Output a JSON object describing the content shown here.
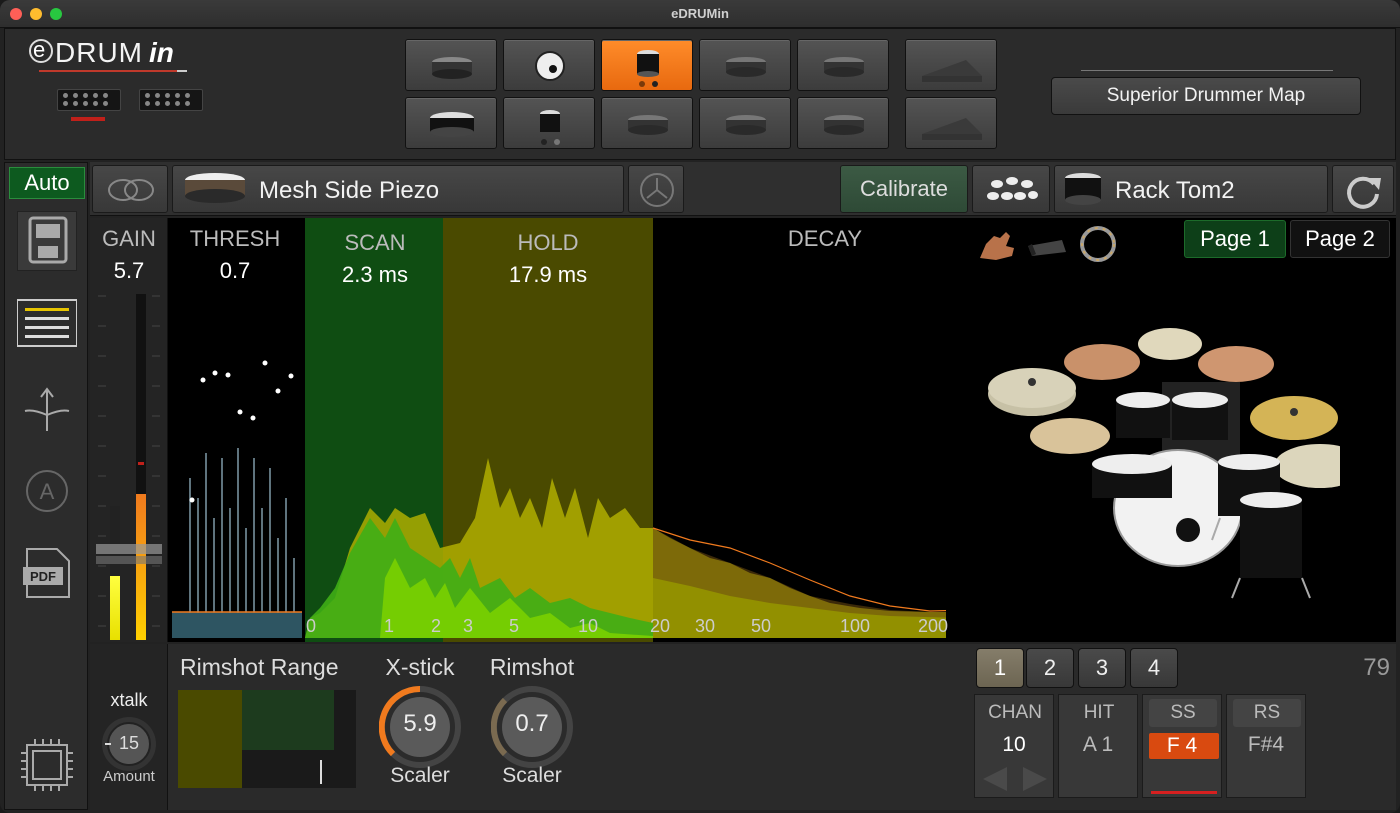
{
  "window": {
    "title": "eDRUMin"
  },
  "logo": {
    "text_e": "e",
    "text_drum": "DRUM",
    "text_in": "in"
  },
  "top": {
    "map_button": "Superior Drummer Map"
  },
  "sidebar": {
    "auto_label": "Auto"
  },
  "toolbar": {
    "input_type": "Mesh Side Piezo",
    "calibrate_label": "Calibrate",
    "instrument": "Rack Tom2"
  },
  "params": {
    "gain_label": "GAIN",
    "gain_value": "5.7",
    "thresh_label": "THRESH",
    "thresh_value": "0.7",
    "scan_label": "SCAN",
    "scan_value": "2.3 ms",
    "hold_label": "HOLD",
    "hold_value": "17.9 ms",
    "decay_label": "DECAY"
  },
  "pages": {
    "page1": "Page 1",
    "page2": "Page 2"
  },
  "axis_ticks": [
    "0",
    "1",
    "2",
    "3",
    "5",
    "10",
    "20",
    "30",
    "50",
    "100",
    "200"
  ],
  "xtalk": {
    "label": "xtalk",
    "value": "15",
    "sub": "Amount"
  },
  "rimshot_range": {
    "label": "Rimshot Range"
  },
  "xstick": {
    "label": "X-stick",
    "value": "5.9",
    "sub": "Scaler",
    "level": 0.59
  },
  "rimshot": {
    "label": "Rimshot",
    "value": "0.7",
    "sub": "Scaler",
    "level": 0.2
  },
  "layers": [
    "1",
    "2",
    "3",
    "4"
  ],
  "velocity": "79",
  "midi": {
    "chan_label": "CHAN",
    "chan_value": "10",
    "hit_label": "HIT",
    "hit_value": "A 1",
    "ss_label": "SS",
    "ss_value": "F 4",
    "rs_label": "RS",
    "rs_value": "F#4"
  },
  "colors": {
    "accent_orange": "#f07a1e",
    "active_green": "#0d5a1f",
    "scan_green": "#0f4d12",
    "hold_olive": "#4a4a00"
  }
}
